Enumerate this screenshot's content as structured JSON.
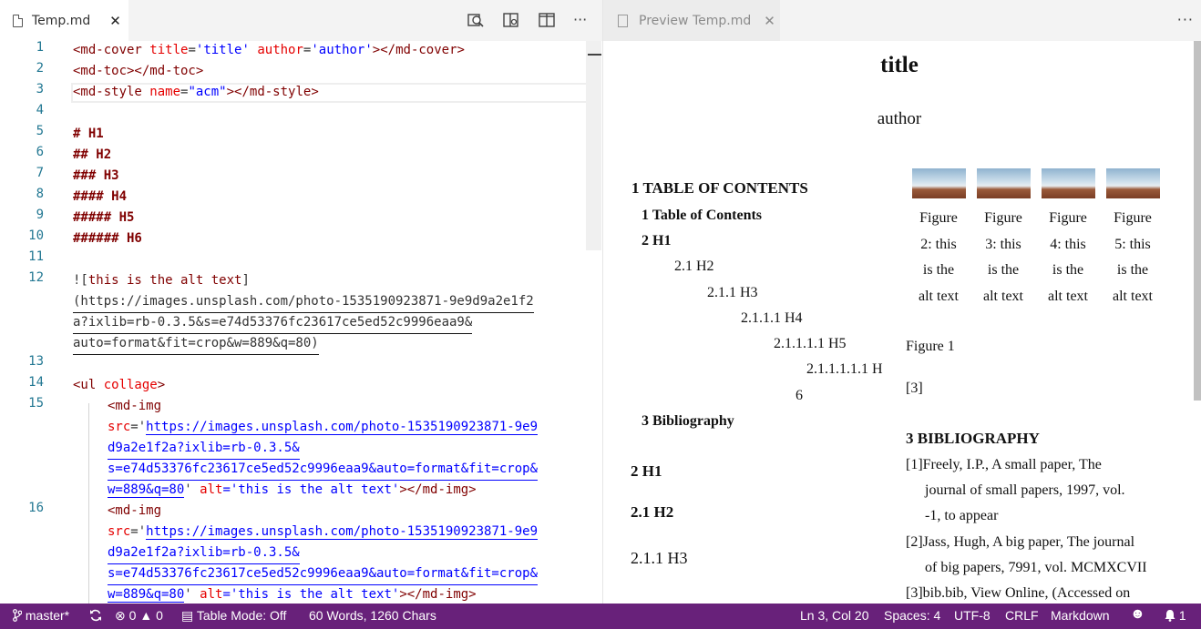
{
  "editor": {
    "tab_label": "Temp.md",
    "tab_close": "✕",
    "toolbar_more": "···",
    "lines": [
      {
        "n": "1"
      },
      {
        "n": "2"
      },
      {
        "n": "3"
      },
      {
        "n": "4"
      },
      {
        "n": "5"
      },
      {
        "n": "6"
      },
      {
        "n": "7"
      },
      {
        "n": "8"
      },
      {
        "n": "9"
      },
      {
        "n": "10"
      },
      {
        "n": "11"
      },
      {
        "n": "12"
      },
      {
        "n": "13"
      },
      {
        "n": "14"
      },
      {
        "n": "15"
      },
      {
        "n": "16"
      }
    ],
    "code": {
      "l1_tag_open": "<md-cover ",
      "l1_attr1": "title",
      "l1_val1": "'title'",
      "l1_attr2": "author",
      "l1_val2": "'author'",
      "l1_tag_close": "></md-cover>",
      "l2": "<md-toc></md-toc>",
      "l3_tag_open": "<md-style ",
      "l3_attr": "name",
      "l3_val": "\"acm\"",
      "l3_tag_close": "></md-style>",
      "l5": "# H1",
      "l6": "## H2",
      "l7": "### H3",
      "l8": "#### H4",
      "l9": "##### H5",
      "l10": "###### H6",
      "l12_open": "![",
      "l12_alt": "this is the alt text",
      "l12_close": "]",
      "l12_w1": "(https://images.unsplash.com/photo-1535190923871-9e9d9a2e1f2",
      "l12_w2": "a?ixlib=rb-0.3.5&s=e74d53376fc23617ce5ed52c9996eaa9&",
      "l12_w3": "auto=format&fit=crop&w=889&q=80)",
      "l14_tag": "<ul ",
      "l14_attr": "collage",
      "l14_close": ">",
      "img_tag": "<md-img",
      "src_attr": "src",
      "src_eq": "='",
      "src_w1": "https://images.unsplash.com/photo-1535190923871-9e9",
      "src_w2": "d9a2e1f2a?ixlib=rb-0.3.5&",
      "src_w3": "s=e74d53376fc23617ce5ed52c9996eaa9&auto=format&fit=crop&",
      "src_w4": "w=889&q=80",
      "src_end": "' ",
      "alt_attr": "alt",
      "alt_val": "='this is the alt text'",
      "img_close": "></md-img>"
    }
  },
  "preview": {
    "tab_label": "Preview Temp.md",
    "tab_close": "✕",
    "more": "···",
    "title": "title",
    "author": "author",
    "toc_heading": "1 TABLE OF CONTENTS",
    "toc": [
      "1 Table of Contents",
      "2 H1",
      "2.1 H2",
      "2.1.1 H3",
      "2.1.1.1 H4",
      "2.1.1.1.1 H5",
      "2.1.1.1.1.1 H",
      "6",
      "3 Bibliography"
    ],
    "figures": [
      {
        "l1": "Figure",
        "l2": "2: this",
        "l3": "is the",
        "l4": "alt text"
      },
      {
        "l1": "Figure",
        "l2": "3: this",
        "l3": "is the",
        "l4": "alt text"
      },
      {
        "l1": "Figure",
        "l2": "4: this",
        "l3": "is the",
        "l4": "alt text"
      },
      {
        "l1": "Figure",
        "l2": "5: this",
        "l3": "is the",
        "l4": "alt text"
      }
    ],
    "figure1": "Figure 1",
    "cite": "[3]",
    "h1": "2 H1",
    "h2": "2.1 H2",
    "h3": "2.1.1 H3",
    "bib_heading": "3 BIBLIOGRAPHY",
    "bib": [
      {
        "l1": "[1]Freely, I.P., A small paper, The",
        "l2": "journal of small papers, 1997, vol.",
        "l3": "-1, to appear"
      },
      {
        "l1": "[2]Jass, Hugh, A big paper, The journal",
        "l2": "of big papers, 7991, vol. MCMXCVII"
      },
      {
        "l1": "[3]bib.bib, View Online, (Accessed on"
      }
    ]
  },
  "status": {
    "branch": "master*",
    "errors": "0",
    "warnings": "0",
    "table_mode": "Table Mode: Off",
    "words": "60 Words, 1260 Chars",
    "position": "Ln 3, Col 20",
    "spaces": "Spaces: 4",
    "encoding": "UTF-8",
    "eol": "CRLF",
    "language": "Markdown",
    "notifications": "1"
  },
  "colors": {
    "statusbar": "#68217a",
    "tag": "#800000",
    "attribute": "#e50000",
    "string": "#0000ff",
    "line_number": "#237893"
  }
}
